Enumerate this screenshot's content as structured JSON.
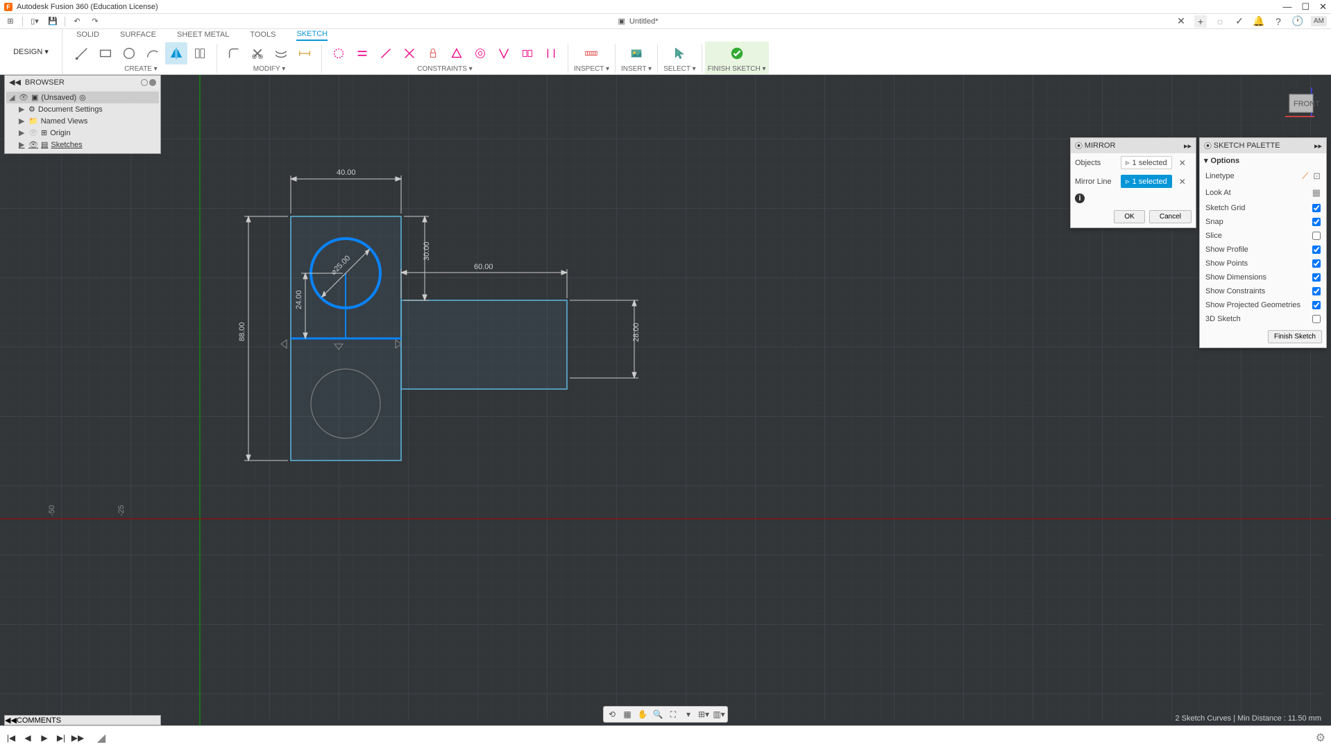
{
  "app": {
    "title": "Autodesk Fusion 360 (Education License)",
    "doc_title": "Untitled*",
    "user_initials": "AM"
  },
  "ribbon": {
    "design_label": "DESIGN ▾",
    "tabs": [
      "SOLID",
      "SURFACE",
      "SHEET METAL",
      "TOOLS",
      "SKETCH"
    ],
    "active_tab": "SKETCH",
    "groups": {
      "create": "CREATE ▾",
      "modify": "MODIFY ▾",
      "constraints": "CONSTRAINTS ▾",
      "inspect": "INSPECT ▾",
      "insert": "INSERT ▾",
      "select": "SELECT ▾",
      "finish": "FINISH SKETCH ▾"
    }
  },
  "browser": {
    "title": "BROWSER",
    "root": "(Unsaved)",
    "items": [
      "Document Settings",
      "Named Views",
      "Origin",
      "Sketches"
    ]
  },
  "mirror": {
    "title": "MIRROR",
    "objects_label": "Objects",
    "objects_value": "1 selected",
    "line_label": "Mirror Line",
    "line_value": "1 selected",
    "ok": "OK",
    "cancel": "Cancel"
  },
  "palette": {
    "title": "SKETCH PALETTE",
    "options_label": "Options",
    "linetype": "Linetype",
    "lookat": "Look At",
    "items": [
      {
        "label": "Sketch Grid",
        "checked": true
      },
      {
        "label": "Snap",
        "checked": true
      },
      {
        "label": "Slice",
        "checked": false
      },
      {
        "label": "Show Profile",
        "checked": true
      },
      {
        "label": "Show Points",
        "checked": true
      },
      {
        "label": "Show Dimensions",
        "checked": true
      },
      {
        "label": "Show Constraints",
        "checked": true
      },
      {
        "label": "Show Projected Geometries",
        "checked": true
      },
      {
        "label": "3D Sketch",
        "checked": false
      }
    ],
    "finish": "Finish Sketch"
  },
  "comments": {
    "title": "COMMENTS"
  },
  "status": {
    "text": "2 Sketch Curves | Min Distance : 11.50 mm"
  },
  "viewcube": {
    "face": "FRONT"
  },
  "dims": {
    "d40": "40.00",
    "d30": "30.00",
    "d60": "60.00",
    "d28": "28.00",
    "d88": "88.00",
    "d24": "24.00",
    "dia25": "⌀25.00",
    "ruler50": "-50",
    "ruler25": "-25"
  }
}
